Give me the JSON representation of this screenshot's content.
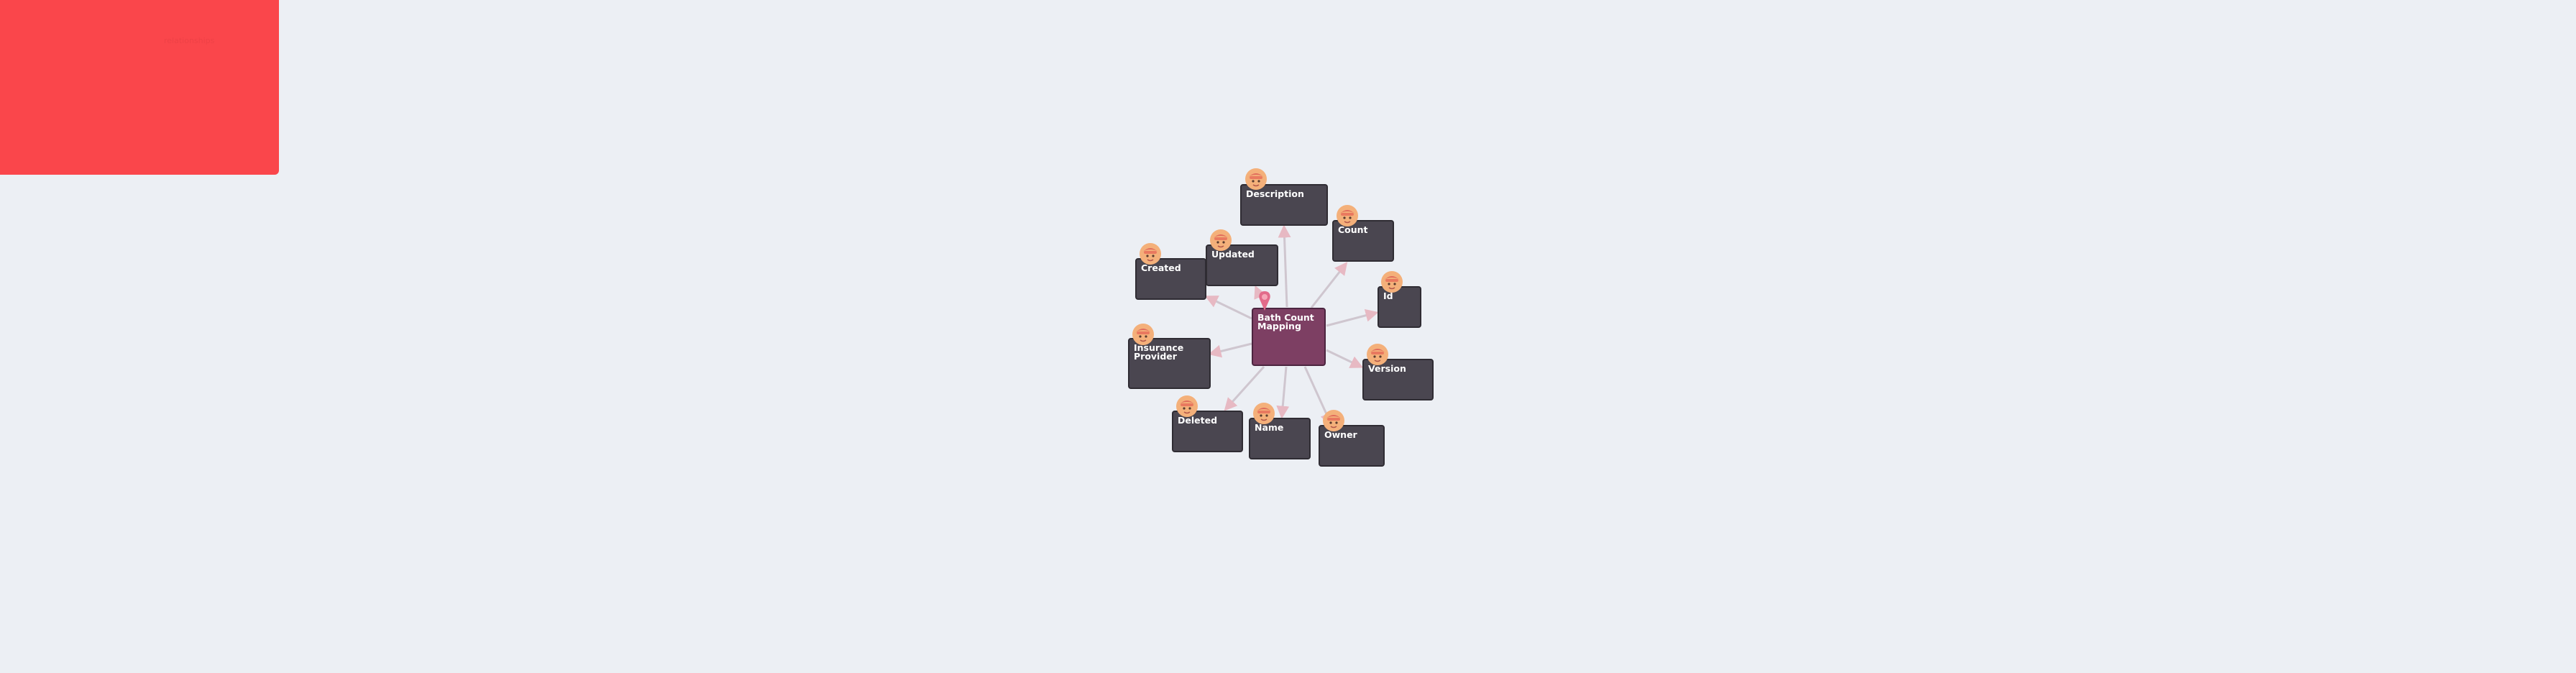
{
  "canvas": {
    "background": "#eceff4",
    "panel_color": "#fa464b",
    "panel_text": "relationships"
  },
  "diagram": {
    "type": "entity-relationship",
    "center": {
      "label_lines": [
        "Bath Count",
        "Mapping"
      ],
      "color": "#7d3f63"
    },
    "nodes": [
      {
        "id": "description",
        "label_lines": [
          "Description"
        ]
      },
      {
        "id": "count",
        "label_lines": [
          "Count"
        ]
      },
      {
        "id": "id",
        "label_lines": [
          "Id"
        ]
      },
      {
        "id": "version",
        "label_lines": [
          "Version"
        ]
      },
      {
        "id": "owner",
        "label_lines": [
          "Owner"
        ]
      },
      {
        "id": "name",
        "label_lines": [
          "Name"
        ]
      },
      {
        "id": "deleted",
        "label_lines": [
          "Deleted"
        ]
      },
      {
        "id": "insurance_provider",
        "label_lines": [
          "Insurance",
          "Provider"
        ]
      },
      {
        "id": "created",
        "label_lines": [
          "Created"
        ]
      },
      {
        "id": "updated",
        "label_lines": [
          "Updated"
        ]
      }
    ],
    "edge_color": "#cfc6cf",
    "arrow_color": "#e7b9c3",
    "node_color": "#4a4650",
    "avatar_icon": "person-avatar-icon"
  }
}
